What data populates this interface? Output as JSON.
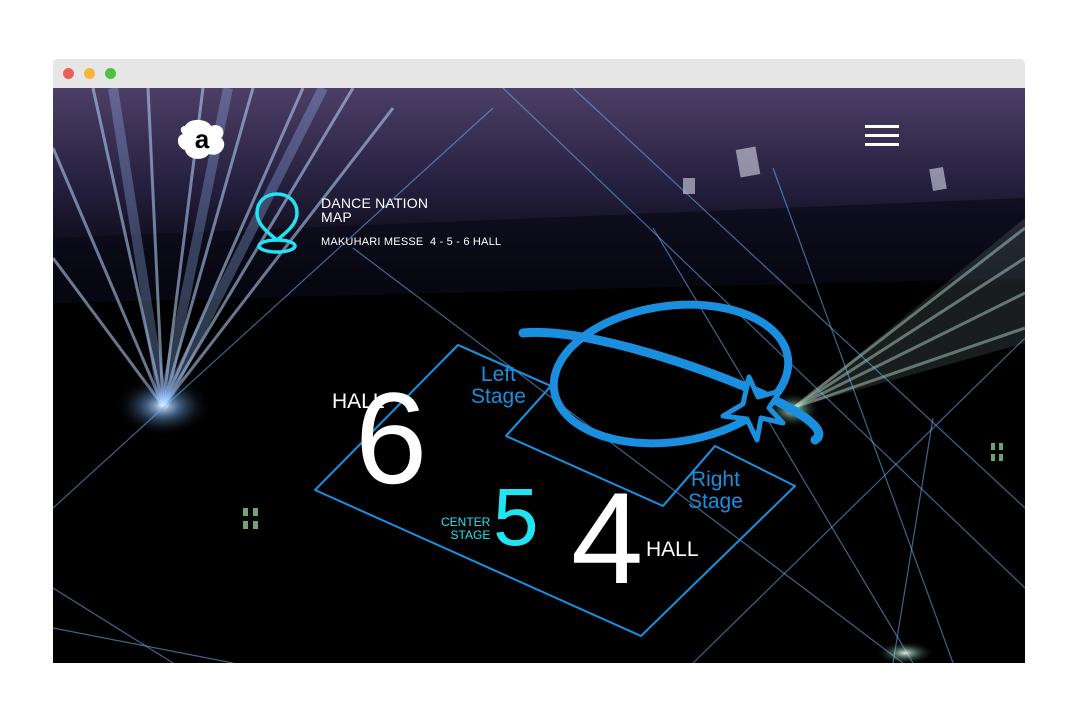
{
  "window": {
    "traffic_lights": [
      {
        "name": "close",
        "color": "#ed5f57"
      },
      {
        "name": "minimize",
        "color": "#f6b83c"
      },
      {
        "name": "maximize",
        "color": "#4fc33f"
      }
    ]
  },
  "header": {
    "logo_icon": "a-logo-icon",
    "menu_icon": "hamburger-menu-icon"
  },
  "map_info": {
    "icon": "map-pin-icon",
    "title_line1": "DANCE NATION",
    "title_line2": "MAP",
    "venue": "MAKUHARI MESSE  4 - 5 - 6 HALL"
  },
  "stage_map": {
    "hall6_label": "HALL",
    "hall6_number": "6",
    "left_stage_line1": "Left",
    "left_stage_line2": "Stage",
    "center_stage_line1": "CENTER",
    "center_stage_line2": "STAGE",
    "hall5_number": "5",
    "hall4_number": "4",
    "hall4_label": "HALL",
    "right_stage_line1": "Right",
    "right_stage_line2": "Stage",
    "planet_icon": "planet-star-icon"
  },
  "colors": {
    "accent_blue": "#1a8fe0",
    "accent_cyan": "#22e4f0",
    "white": "#ffffff",
    "background": "#000000"
  }
}
